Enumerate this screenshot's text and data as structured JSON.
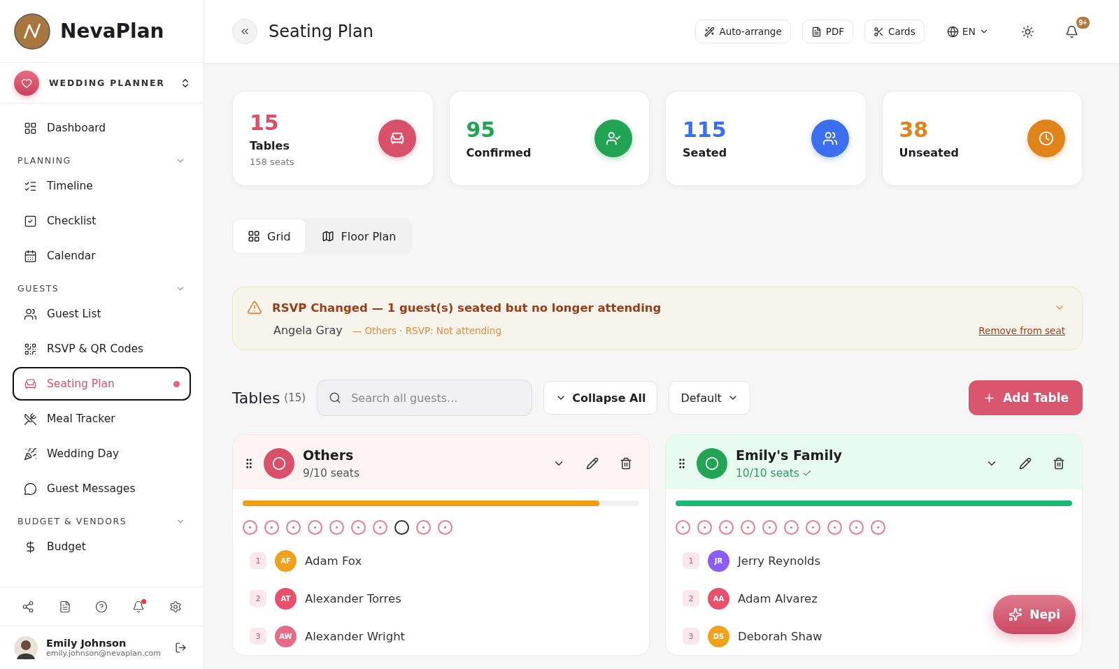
{
  "brand": {
    "name": "NevaPlan"
  },
  "workspace": {
    "label": "WEDDING PLANNER"
  },
  "sidebar": {
    "items": [
      {
        "kind": "link",
        "label": "Dashboard",
        "selected": false
      },
      {
        "kind": "section",
        "label": "PLANNING",
        "expanded": true
      },
      {
        "kind": "link",
        "label": "Timeline",
        "selected": false
      },
      {
        "kind": "link",
        "label": "Checklist",
        "selected": false
      },
      {
        "kind": "link",
        "label": "Calendar",
        "selected": false
      },
      {
        "kind": "section",
        "label": "GUESTS",
        "expanded": true
      },
      {
        "kind": "link",
        "label": "Guest List",
        "selected": false
      },
      {
        "kind": "link",
        "label": "RSVP & QR Codes",
        "selected": false
      },
      {
        "kind": "link",
        "label": "Seating Plan",
        "selected": true
      },
      {
        "kind": "link",
        "label": "Meal Tracker",
        "selected": false
      },
      {
        "kind": "link",
        "label": "Wedding Day",
        "selected": false
      },
      {
        "kind": "link",
        "label": "Guest Messages",
        "selected": false
      },
      {
        "kind": "section",
        "label": "BUDGET & VENDORS",
        "expanded": true
      },
      {
        "kind": "link",
        "label": "Budget",
        "selected": false
      }
    ]
  },
  "footer_icons": [
    {
      "kind": "share",
      "badge": false
    },
    {
      "kind": "document",
      "badge": false
    },
    {
      "kind": "help",
      "badge": false
    },
    {
      "kind": "bell",
      "badge": true
    },
    {
      "kind": "settings",
      "badge": false
    }
  ],
  "user": {
    "name": "Emily Johnson",
    "email": "emily.johnson@nevaplan.com"
  },
  "header": {
    "title": "Seating Plan",
    "actions": [
      {
        "kind": "wand",
        "label": "Auto-arrange"
      },
      {
        "kind": "file",
        "label": "PDF"
      },
      {
        "kind": "scissors",
        "label": "Cards"
      }
    ],
    "language": "EN",
    "notifications": "9+"
  },
  "stats": [
    {
      "kind": "tables",
      "value": "15",
      "label": "Tables",
      "sub": "158 seats"
    },
    {
      "kind": "confirmed",
      "value": "95",
      "label": "Confirmed"
    },
    {
      "kind": "seated",
      "value": "115",
      "label": "Seated"
    },
    {
      "kind": "unseated",
      "value": "38",
      "label": "Unseated"
    }
  ],
  "view_tabs": [
    {
      "kind": "grid",
      "label": "Grid",
      "selected": true
    },
    {
      "kind": "map",
      "label": "Floor Plan",
      "selected": false
    }
  ],
  "alert": {
    "title": "RSVP Changed — 1 guest(s) seated but no longer attending",
    "expanded": true,
    "guest": "Angela Gray",
    "detail": "— Others · RSVP: Not attending",
    "action": "Remove from seat"
  },
  "toolbar": {
    "title": "Tables",
    "count": "(15)",
    "search_placeholder": "Search all guests...",
    "collapse": "Collapse All",
    "sort": "Default",
    "add": "Add Table"
  },
  "tables": [
    {
      "name": "Others",
      "color": "#d9506b",
      "seats_text": "9/10 seats",
      "full": false,
      "level": 0.9,
      "seats": [
        {
          "occupied": true
        },
        {
          "occupied": true
        },
        {
          "occupied": true
        },
        {
          "occupied": true
        },
        {
          "occupied": true
        },
        {
          "occupied": true
        },
        {
          "occupied": true
        },
        {
          "occupied": false
        },
        {
          "occupied": true
        },
        {
          "occupied": true
        }
      ],
      "guests": [
        {
          "number": "1",
          "initials": "AF",
          "name": "Adam Fox",
          "color": "#f0a21c"
        },
        {
          "number": "2",
          "initials": "AT",
          "name": "Alexander Torres",
          "color": "#e8506e"
        },
        {
          "number": "3",
          "initials": "AW",
          "name": "Alexander Wright",
          "color": "#e56b86"
        }
      ]
    },
    {
      "name": "Emily's Family",
      "color": "#23a455",
      "seats_text": "10/10 seats",
      "full": true,
      "level": 1,
      "seats": [
        {
          "occupied": true
        },
        {
          "occupied": true
        },
        {
          "occupied": true
        },
        {
          "occupied": true
        },
        {
          "occupied": true
        },
        {
          "occupied": true
        },
        {
          "occupied": true
        },
        {
          "occupied": true
        },
        {
          "occupied": true
        },
        {
          "occupied": true
        }
      ],
      "guests": [
        {
          "number": "1",
          "initials": "JR",
          "name": "Jerry Reynolds",
          "color": "#8b5cf6"
        },
        {
          "number": "2",
          "initials": "AA",
          "name": "Adam Alvarez",
          "color": "#e8506e"
        },
        {
          "number": "3",
          "initials": "DS",
          "name": "Deborah Shaw",
          "color": "#f0a21c"
        }
      ]
    }
  ],
  "assistant": {
    "label": "Nepi"
  }
}
